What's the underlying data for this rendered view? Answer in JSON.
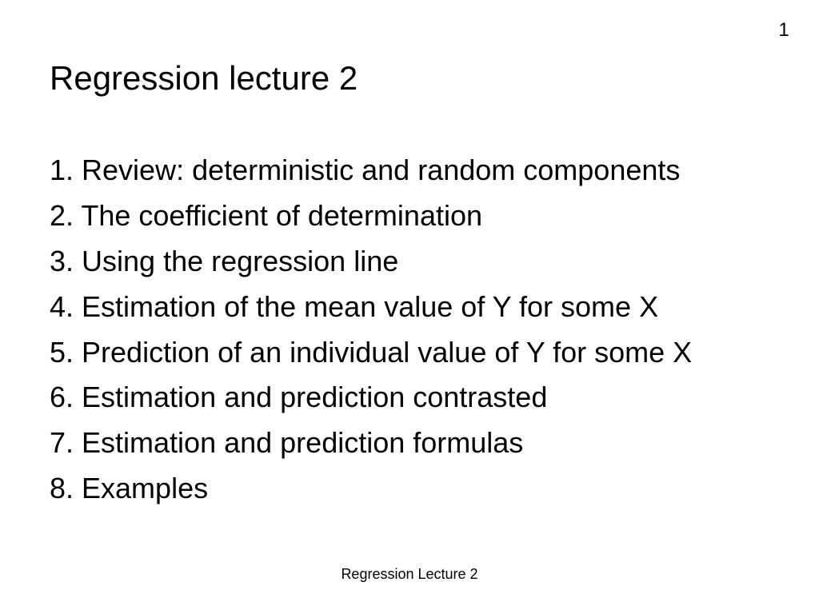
{
  "slide": {
    "number": "1",
    "title": "Regression lecture 2",
    "items": [
      "1. Review: deterministic and random components",
      "2. The coefficient of determination",
      "3. Using the regression line",
      "4. Estimation of the mean value of Y for some X",
      "5. Prediction of an individual value of Y for some X",
      "6. Estimation and prediction contrasted",
      "7. Estimation and prediction formulas",
      "8. Examples"
    ],
    "footer": "Regression Lecture 2"
  }
}
